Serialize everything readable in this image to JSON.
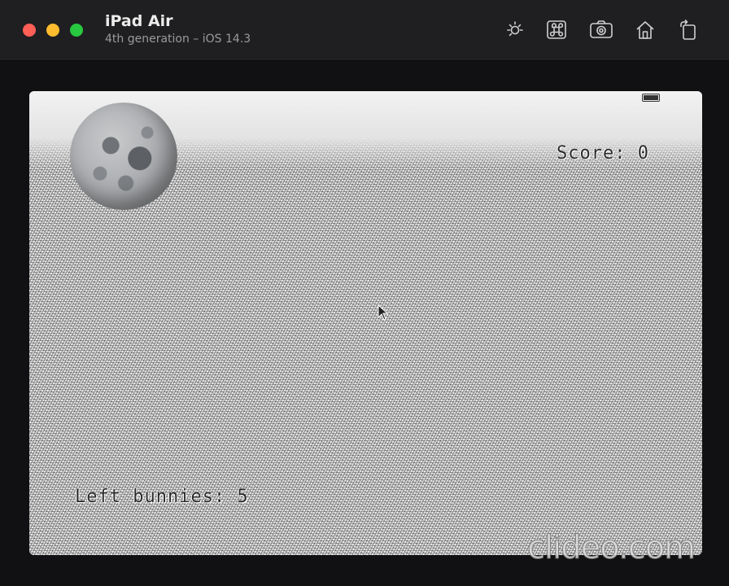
{
  "window": {
    "title": "iPad Air",
    "subtitle": "4th generation – iOS 14.3",
    "controls": [
      "close",
      "minimize",
      "zoom"
    ]
  },
  "toolbar": {
    "icons": [
      "brightness-icon",
      "command-key-icon",
      "screenshot-camera-icon",
      "home-icon",
      "rotate-icon"
    ]
  },
  "game": {
    "score_label": "Score: 0",
    "bunnies_label": "Left bunnies: 5"
  },
  "watermark": {
    "text": "clideo.com"
  },
  "colors": {
    "close": "#fe5f57",
    "minimize": "#febc2e",
    "zoom": "#28c840",
    "titlebar": "#1f1f21"
  }
}
